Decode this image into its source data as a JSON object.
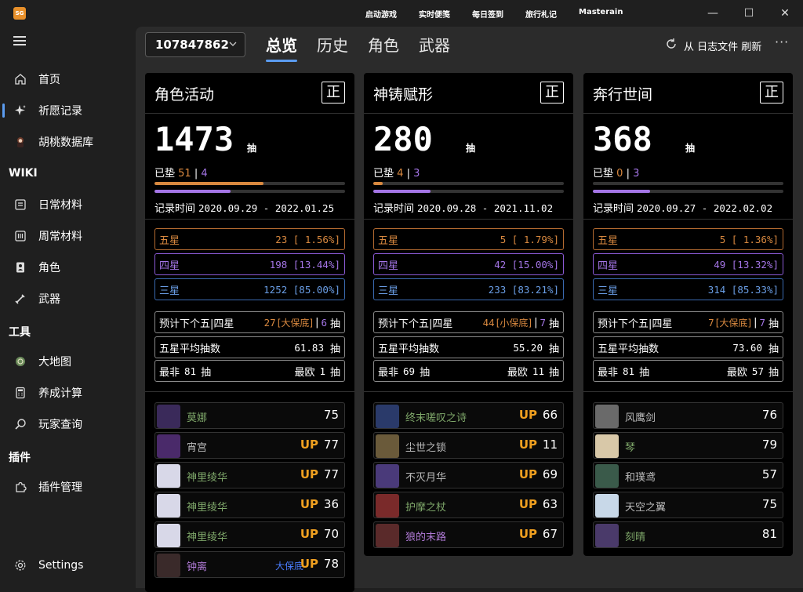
{
  "titlebar": {
    "logo": "SG",
    "links": [
      "启动游戏",
      "实时便笺",
      "每日签到",
      "旅行札记",
      "Masterain"
    ],
    "minimize": "—",
    "maximize": "☐",
    "close": "✕"
  },
  "sidebar": {
    "items": [
      {
        "label": "首页",
        "icon": "home-icon"
      },
      {
        "label": "祈愿记录",
        "icon": "sparkle-icon",
        "selected": true
      },
      {
        "label": "胡桃数据库",
        "icon": "hutao-icon"
      }
    ],
    "wiki_title": "WIKI",
    "wiki_items": [
      {
        "label": "日常材料",
        "icon": "daily-material-icon"
      },
      {
        "label": "周常材料",
        "icon": "weekly-material-icon"
      },
      {
        "label": "角色",
        "icon": "character-icon"
      },
      {
        "label": "武器",
        "icon": "weapon-icon"
      }
    ],
    "tools_title": "工具",
    "tools_items": [
      {
        "label": "大地图",
        "icon": "map-icon"
      },
      {
        "label": "养成计算",
        "icon": "calculator-icon"
      },
      {
        "label": "玩家查询",
        "icon": "search-icon"
      }
    ],
    "plugins_title": "插件",
    "plugins_items": [
      {
        "label": "插件管理",
        "icon": "puzzle-icon"
      }
    ],
    "settings": "Settings"
  },
  "main": {
    "uid": "107847862",
    "tabs": [
      "总览",
      "历史",
      "角色",
      "武器"
    ],
    "active_tab": "总览",
    "refresh_label": "从 日志文件 刷新",
    "more": "···"
  },
  "colors": {
    "five_star": "#d8883f",
    "four_star": "#a475e6",
    "three_star": "#6a9ee6",
    "up": "#f0a020",
    "accent": "#5b9cf0"
  },
  "cards": [
    {
      "title": "角色活动",
      "badge": "正",
      "total": "1473",
      "unit": "抽",
      "pity_label": "已垫",
      "pity_five": "51",
      "pity_sep": "|",
      "pity_four": "4",
      "pity_five_fraction": 0.57,
      "pity_four_fraction": 0.4,
      "date_label": "记录时间",
      "date_range": "2020.09.29 - 2022.01.25",
      "five_label": "五星",
      "five_value": "23 [ 1.56%]",
      "four_label": "四星",
      "four_value": "198 [13.44%]",
      "three_label": "三星",
      "three_value": "1252 [85.00%]",
      "predict_label": "预计下个五|四星",
      "predict_five": "27",
      "predict_note": "[大保底]",
      "predict_four": "6",
      "predict_unit": "抽",
      "avg_label": "五星平均抽数",
      "avg_value": "61.83",
      "avg_unit": "抽",
      "worst_label": "最非",
      "worst_value": "81",
      "worst_unit": "抽",
      "best_label": "最欧",
      "best_value": "1",
      "best_unit": "抽",
      "items": [
        {
          "name": "莫娜",
          "count": "75",
          "up": "",
          "color": "green"
        },
        {
          "name": "宵宫",
          "count": "77",
          "up": "UP",
          "color": "gray"
        },
        {
          "name": "神里绫华",
          "count": "77",
          "up": "UP",
          "color": "green"
        },
        {
          "name": "神里绫华",
          "count": "36",
          "up": "UP",
          "color": "green"
        },
        {
          "name": "神里绫华",
          "count": "70",
          "up": "UP",
          "color": "green"
        },
        {
          "name": "钟离",
          "count": "78",
          "up": "UP",
          "color": "purple",
          "note": "大保底"
        }
      ]
    },
    {
      "title": "神铸赋形",
      "badge": "正",
      "total": "280",
      "unit": "抽",
      "pity_label": "已垫",
      "pity_five": "4",
      "pity_sep": "|",
      "pity_four": "3",
      "pity_five_fraction": 0.05,
      "pity_four_fraction": 0.3,
      "date_label": "记录时间",
      "date_range": "2020.09.28 - 2021.11.02",
      "five_label": "五星",
      "five_value": "5 [ 1.79%]",
      "four_label": "四星",
      "four_value": "42 [15.00%]",
      "three_label": "三星",
      "three_value": "233 [83.21%]",
      "predict_label": "预计下个五|四星",
      "predict_five": "44",
      "predict_note": "[小保底]",
      "predict_four": "7",
      "predict_unit": "抽",
      "avg_label": "五星平均抽数",
      "avg_value": "55.20",
      "avg_unit": "抽",
      "worst_label": "最非",
      "worst_value": "69",
      "worst_unit": "抽",
      "best_label": "最欧",
      "best_value": "11",
      "best_unit": "抽",
      "items": [
        {
          "name": "终末嗟叹之诗",
          "count": "66",
          "up": "UP",
          "color": "green"
        },
        {
          "name": "尘世之锁",
          "count": "11",
          "up": "UP",
          "color": "gray"
        },
        {
          "name": "不灭月华",
          "count": "69",
          "up": "UP",
          "color": "gray"
        },
        {
          "name": "护摩之杖",
          "count": "63",
          "up": "UP",
          "color": "green"
        },
        {
          "name": "狼的末路",
          "count": "67",
          "up": "UP",
          "color": "purple"
        }
      ]
    },
    {
      "title": "奔行世间",
      "badge": "正",
      "total": "368",
      "unit": "抽",
      "pity_label": "已垫",
      "pity_five": "0",
      "pity_sep": "|",
      "pity_four": "3",
      "pity_five_fraction": 0.0,
      "pity_four_fraction": 0.3,
      "date_label": "记录时间",
      "date_range": "2020.09.27 - 2022.02.02",
      "five_label": "五星",
      "five_value": "5 [ 1.36%]",
      "four_label": "四星",
      "four_value": "49 [13.32%]",
      "three_label": "三星",
      "three_value": "314 [85.33%]",
      "predict_label": "预计下个五|四星",
      "predict_five": "7",
      "predict_note": "[大保底]",
      "predict_four": "7",
      "predict_unit": "抽",
      "avg_label": "五星平均抽数",
      "avg_value": "73.60",
      "avg_unit": "抽",
      "worst_label": "最非",
      "worst_value": "81",
      "worst_unit": "抽",
      "best_label": "最欧",
      "best_value": "57",
      "best_unit": "抽",
      "items": [
        {
          "name": "风鹰剑",
          "count": "76",
          "up": "",
          "color": "gray"
        },
        {
          "name": "琴",
          "count": "79",
          "up": "",
          "color": "green"
        },
        {
          "name": "和璞鸢",
          "count": "57",
          "up": "",
          "color": "gray"
        },
        {
          "name": "天空之翼",
          "count": "75",
          "up": "",
          "color": "gray"
        },
        {
          "name": "刻晴",
          "count": "81",
          "up": "",
          "color": "green"
        }
      ]
    }
  ]
}
